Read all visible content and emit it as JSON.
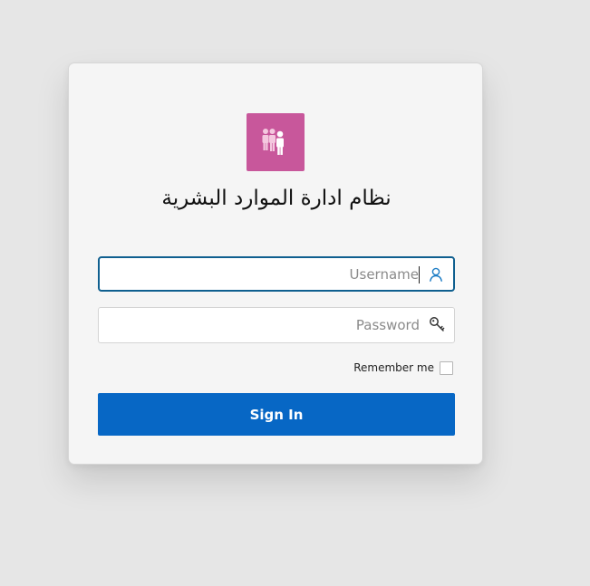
{
  "app": {
    "title": "نظام ادارة الموارد البشرية",
    "logo_icon": "people-group-icon",
    "logo_color": "#c8579b"
  },
  "login": {
    "username_placeholder": "Username",
    "username_value": "",
    "username_icon": "user-icon",
    "password_placeholder": "Password",
    "password_value": "",
    "password_icon": "key-icon",
    "remember_label": "Remember me",
    "remember_checked": false,
    "signin_label": "Sign In"
  },
  "colors": {
    "accent": "#0767c5",
    "focus_border": "#0f5f8f"
  }
}
